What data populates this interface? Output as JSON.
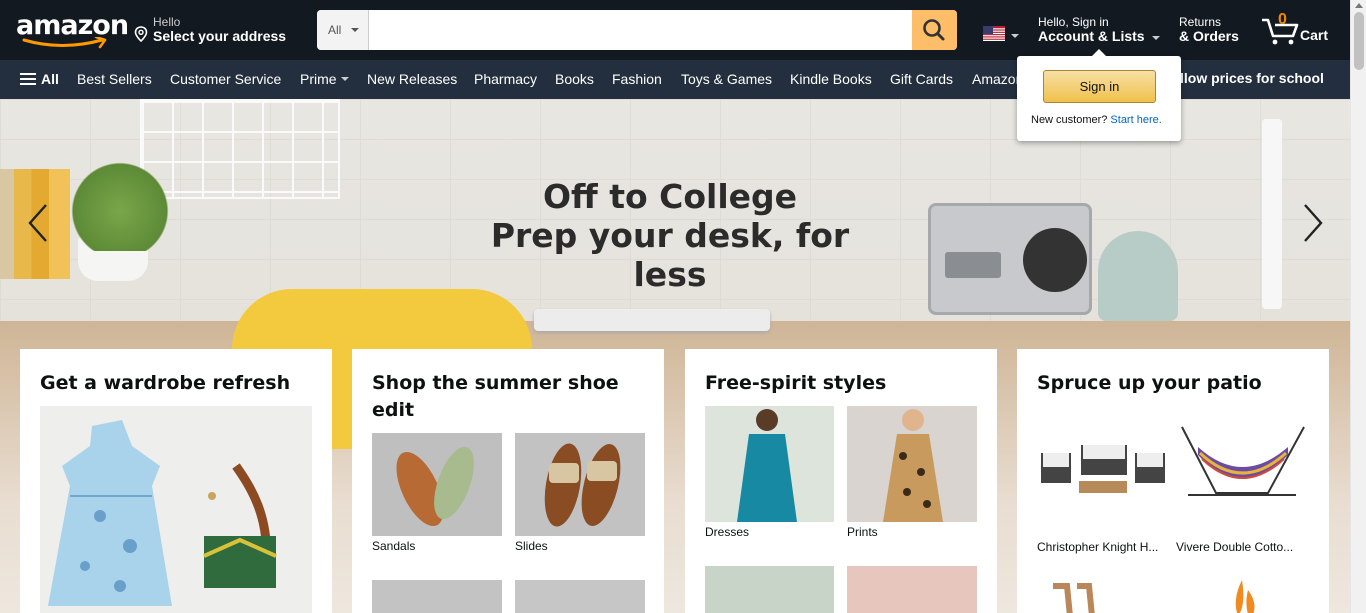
{
  "header": {
    "logo": "amazon",
    "deliver": {
      "line1": "Hello",
      "line2": "Select your address"
    },
    "search": {
      "category": "All",
      "placeholder": "",
      "value": ""
    },
    "account": {
      "line1": "Hello, Sign in",
      "line2": "Account & Lists"
    },
    "orders": {
      "line1": "Returns",
      "line2": "& Orders"
    },
    "cart": {
      "count": "0",
      "label": "Cart"
    }
  },
  "subnav": {
    "all": "All",
    "items": [
      "Best Sellers",
      "Customer Service",
      "Prime",
      "New Releases",
      "Pharmacy",
      "Books",
      "Fashion",
      "Toys & Games",
      "Kindle Books",
      "Gift Cards",
      "Amazon"
    ],
    "promo": "llow prices for school"
  },
  "hero": {
    "line1": "Off to College",
    "line2": "Prep your desk, for less"
  },
  "signin_popover": {
    "button": "Sign in",
    "new_customer": "New customer?",
    "start_here": "Start here."
  },
  "cards": [
    {
      "title": "Get a wardrobe refresh"
    },
    {
      "title": "Shop the summer shoe edit",
      "tiles": [
        "Sandals",
        "Slides"
      ]
    },
    {
      "title": "Free-spirit styles",
      "tiles": [
        "Dresses",
        "Prints"
      ]
    },
    {
      "title": "Spruce up your patio",
      "tiles": [
        "Christopher Knight H...",
        "Vivere Double Cotto..."
      ]
    }
  ],
  "colors": {
    "nav_top": "#131921",
    "nav_sub": "#232f3e",
    "search_button": "#febd69",
    "cart_count": "#f08804",
    "link": "#0066c0"
  }
}
